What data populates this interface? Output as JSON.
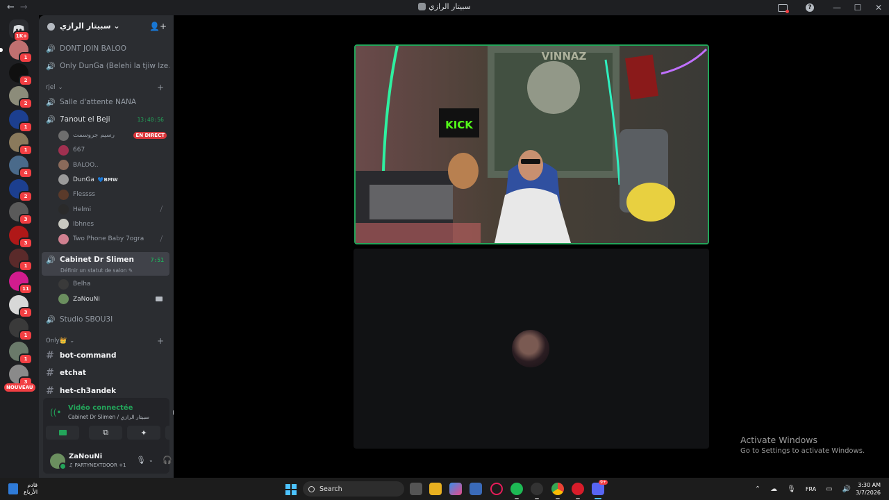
{
  "titlebar": {
    "title": "سبيتار الرازي",
    "back": "←",
    "forward": "→",
    "minimize": "—",
    "maximize": "☐",
    "close": "✕",
    "help": "?"
  },
  "rail": {
    "home_badge": "1K+",
    "servers": [
      {
        "badge": "1",
        "color": "#c07070"
      },
      {
        "badge": "2",
        "color": "#101010"
      },
      {
        "badge": "2",
        "color": "#8c8c7a"
      },
      {
        "badge": "1",
        "color": "#1c3f8f"
      },
      {
        "badge": "1",
        "color": "#8a7a5c"
      },
      {
        "badge": "4",
        "color": "#4a6a8a"
      },
      {
        "badge": "2",
        "color": "#1c3f8f"
      },
      {
        "badge": "3",
        "color": "#5a5a5a"
      },
      {
        "badge": "3",
        "color": "#b01818"
      },
      {
        "badge": "1",
        "color": "#5a2a2a"
      },
      {
        "badge": "11",
        "color": "#d11c8e"
      },
      {
        "badge": "3",
        "color": "#d8d8d8"
      },
      {
        "badge": "1",
        "color": "#3a3a3a"
      },
      {
        "badge": "1",
        "color": "#6a7a6a"
      },
      {
        "badge": "3",
        "color": "#8a8a8a"
      }
    ],
    "new_label": "NOUVEAU"
  },
  "server": {
    "name": "سبيتار الرازي"
  },
  "channels_top": [
    {
      "name": "DONT JOIN BALOO"
    },
    {
      "name": "Only DunGa (Belehi la tjiw lze..."
    }
  ],
  "category_rjel": "rjel",
  "channel_salle": "Salle d'attente NANA",
  "channel_7anout": {
    "name": "7anout el Beji",
    "timer": "13:40:56"
  },
  "users_7anout": [
    {
      "name": "رسيم جروسمت",
      "live": "EN DIRECT",
      "color": "#6e6e6e"
    },
    {
      "name": "667",
      "color": "#a03050"
    },
    {
      "name": "BALOO..",
      "color": "#8a6a5a"
    },
    {
      "name": "DunGa",
      "tag": "BMW",
      "tag_icon": "💙",
      "color": "#9a9a9a"
    },
    {
      "name": "Flessss",
      "color": "#5a3a2a"
    },
    {
      "name": "Helmi",
      "muted": "⧸",
      "color": "#2a2a2a"
    },
    {
      "name": "Ibhnes",
      "color": "#c8c8c0"
    },
    {
      "name": "Two Phone Baby 7ogra",
      "muted": "⧸",
      "color": "#d08090"
    }
  ],
  "channel_cabinet": {
    "name": "Cabinet Dr Slimen",
    "timer": "7:51",
    "status": "Définir un statut de salon ✎"
  },
  "users_cabinet": [
    {
      "name": "Belha",
      "color": "#3a3a3a"
    },
    {
      "name": "ZaNouNi",
      "color": "#6b8f5f"
    }
  ],
  "channel_studio": "Studio SBOU3I",
  "category_only": "Only👑",
  "text_channels": [
    "bot-command",
    "etchat",
    "het-ch3andek"
  ],
  "voice_panel": {
    "status": "Vidéo connectée",
    "location": "Cabinet Dr Slimen / سبيتار الرازي"
  },
  "user_panel": {
    "name": "ZaNouNi",
    "status": "♫ PARTYNEXTDOOR +1"
  },
  "activate": {
    "line1": "Activate Windows",
    "line2": "Go to Settings to activate Windows."
  },
  "taskbar": {
    "widget_line1": "قادم",
    "widget_line2": "الأرباع",
    "search_placeholder": "Search",
    "lang": "FRA",
    "time": "3:30 AM",
    "date": "3/7/2026",
    "discord_badge": "9+"
  },
  "stream": {
    "sign": "KICK",
    "wall_text": "VINNAZ"
  }
}
